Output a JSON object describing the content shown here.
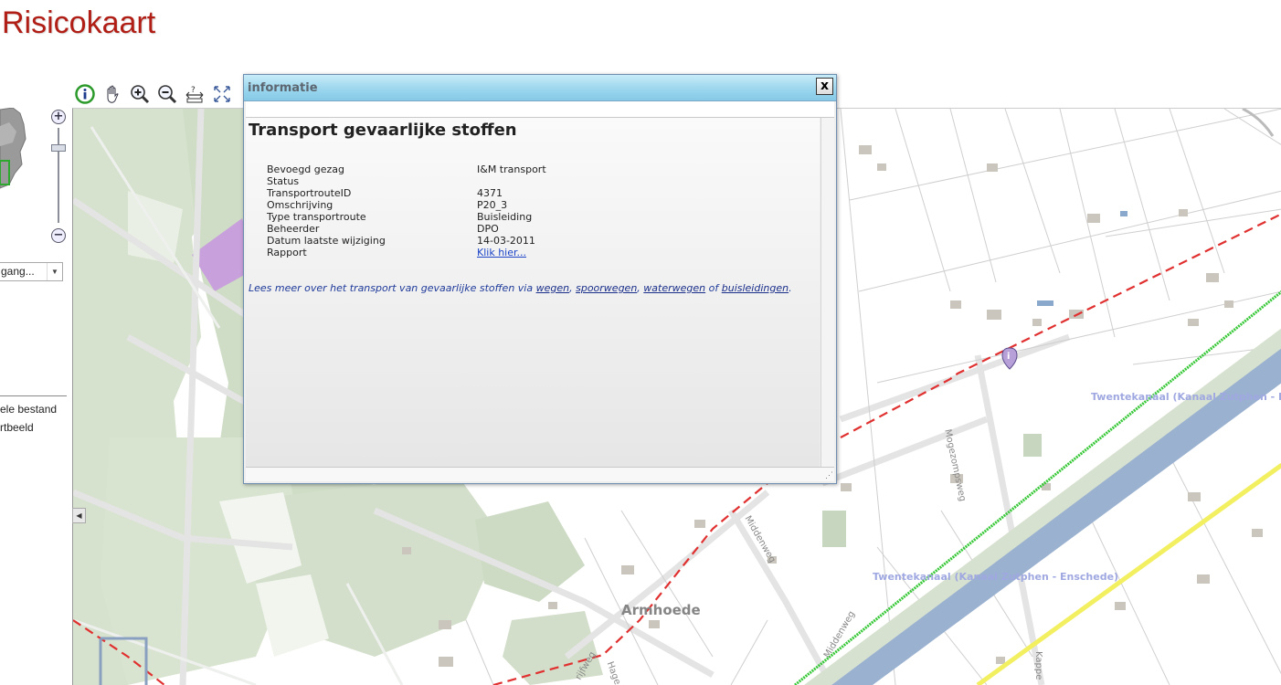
{
  "app": {
    "title": "Risicokaart"
  },
  "sidebar": {
    "zoom_in": "+",
    "zoom_out": "−",
    "layer_select_value": "gang...",
    "links": [
      "ele bestand",
      "rtbeeld"
    ]
  },
  "toolbar": {
    "tools": [
      "info-icon",
      "pan-hand-icon",
      "zoom-in-icon",
      "zoom-out-icon",
      "measure-icon",
      "full-extent-icon"
    ]
  },
  "map": {
    "labels": {
      "place": "Armhoede",
      "canal_1": "Twentekanaal (Kanaal Zutphen - E",
      "canal_2": "Twentekanaal (Kanaal Zutphen - Enschede)",
      "road_mogezomp": "Mogezompsweg",
      "road_midden": "Middenweg",
      "road_midden_2": "Middenweg",
      "road_hage": "Hage",
      "road_rijfweg": "rijfweg",
      "road_kappe": "Kappe"
    },
    "colors": {
      "background": "#ffffff",
      "forest": "#d5e0cc",
      "water": "#98b0d0",
      "hazard_route_red": "#e03030",
      "route_green": "#3ec63e",
      "route_yellow": "#f0ee70",
      "selected_area": "#c9a0dc"
    }
  },
  "dialog": {
    "title": "informatie",
    "close": "x",
    "heading": "Transport gevaarlijke stoffen",
    "fields": [
      {
        "label": "Bevoegd gezag",
        "value": "I&M transport"
      },
      {
        "label": "Status",
        "value": ""
      },
      {
        "label": "TransportrouteID",
        "value": "4371"
      },
      {
        "label": "Omschrijving",
        "value": "P20_3"
      },
      {
        "label": "Type transportroute",
        "value": "Buisleiding"
      },
      {
        "label": "Beheerder",
        "value": "DPO"
      },
      {
        "label": "Datum laatste wijziging",
        "value": "14-03-2011"
      },
      {
        "label": "Rapport",
        "value": "Klik hier..."
      }
    ],
    "note": {
      "prefix": "Lees meer over het transport van gevaarlijke stoffen via ",
      "link_wegen": "wegen",
      "sep1": ", ",
      "link_spoorwegen": "spoorwegen",
      "sep2": ", ",
      "link_waterwegen": "waterwegen",
      "sep3": " of ",
      "link_buisleidingen": "buisleidingen",
      "suffix": "."
    }
  }
}
